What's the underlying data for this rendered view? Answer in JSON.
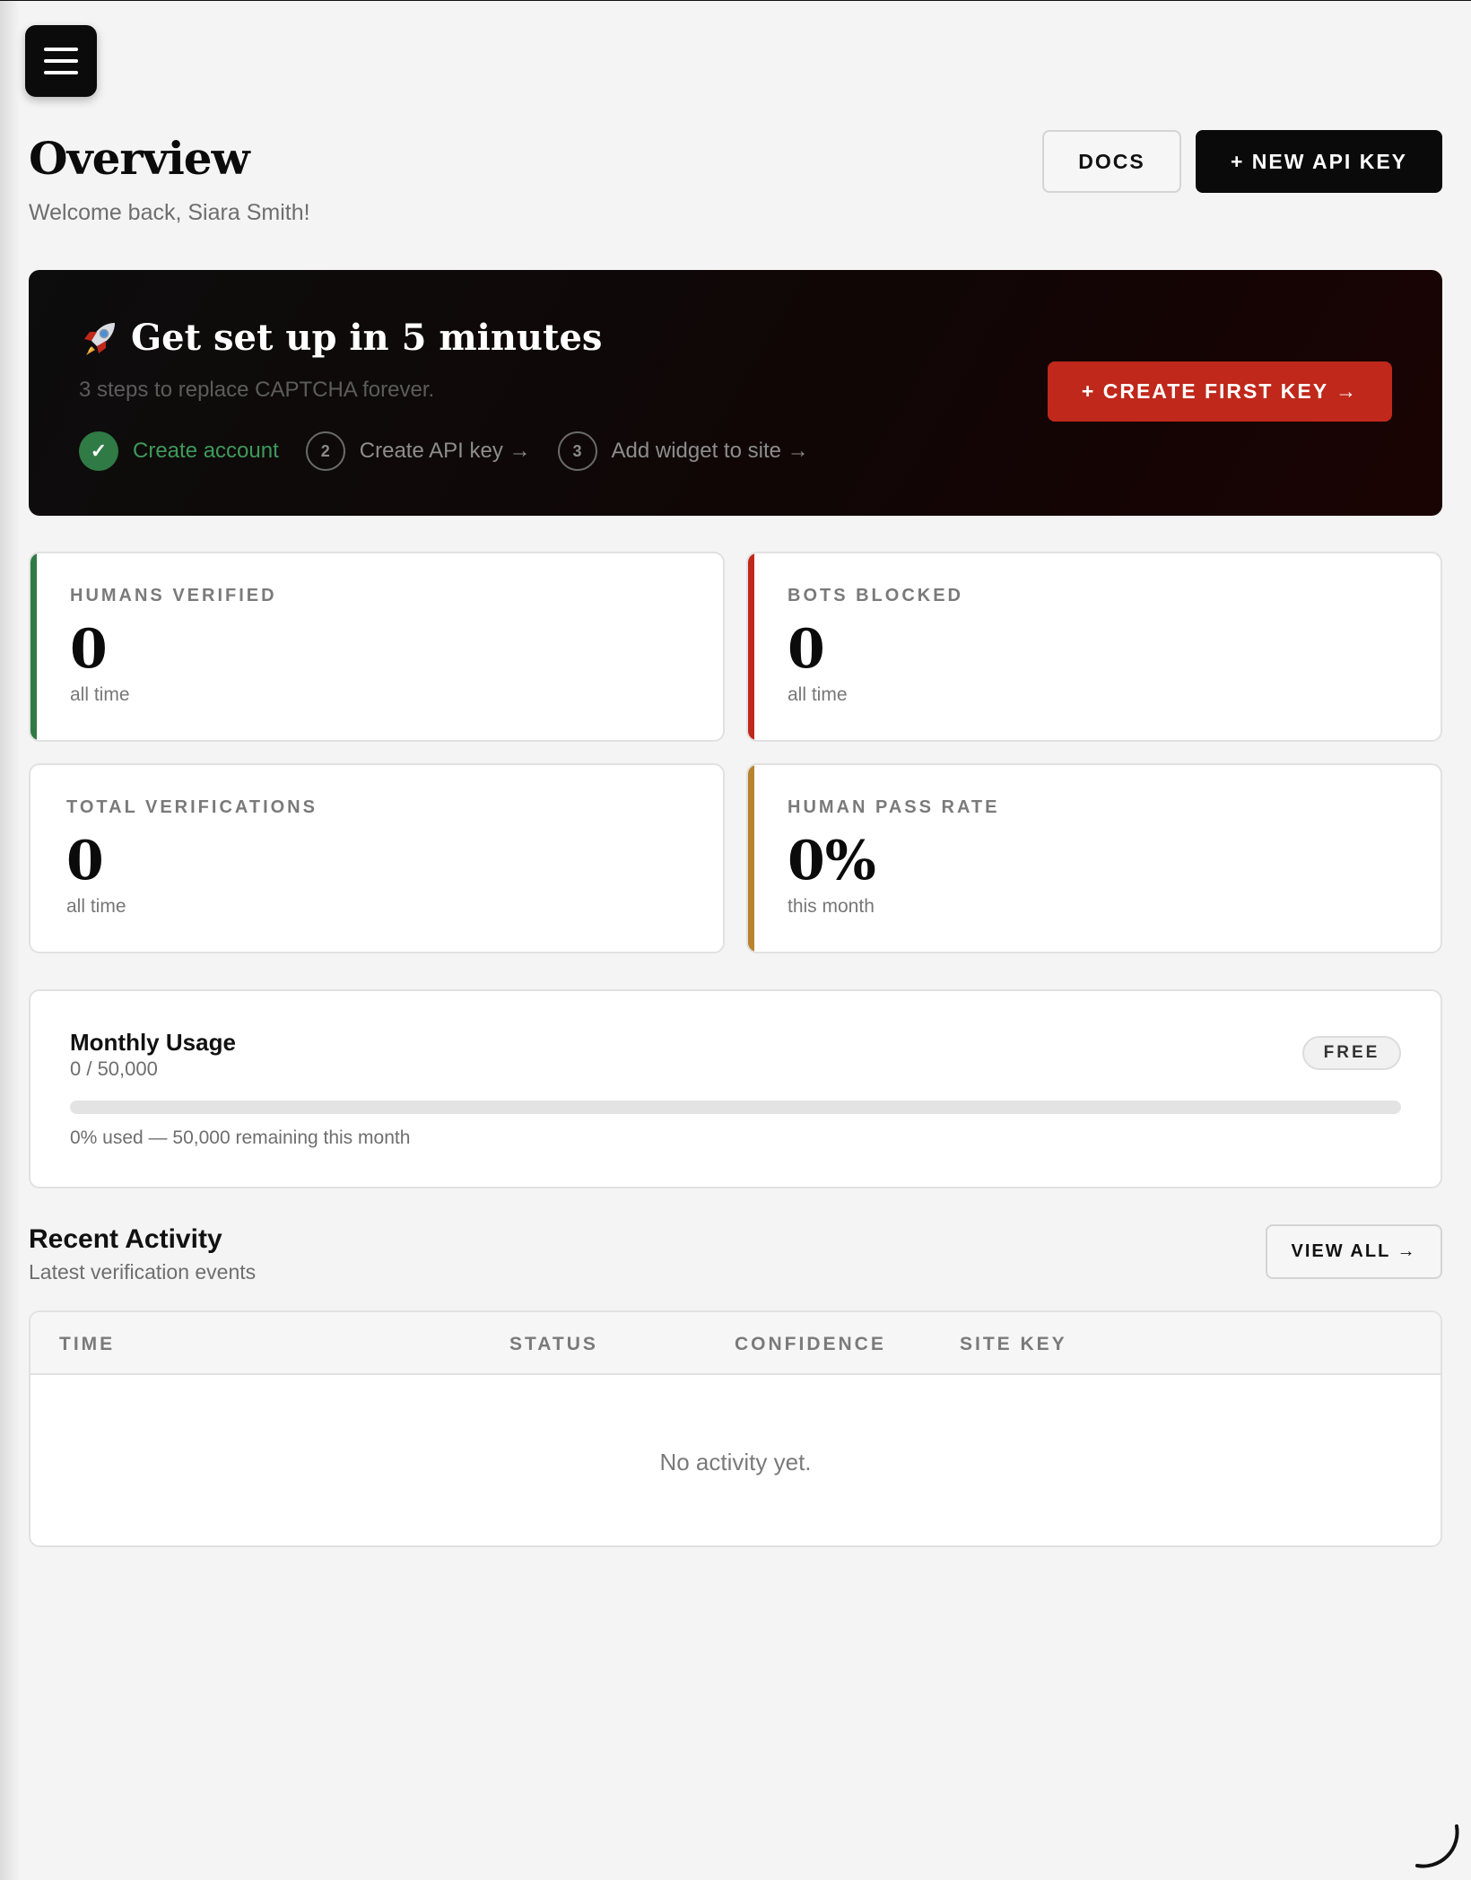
{
  "header": {
    "title": "Overview",
    "welcome": "Welcome back, Siara Smith!",
    "docs_label": "DOCS",
    "new_key_label": "+ NEW API KEY"
  },
  "setup": {
    "title": "Get set up in 5 minutes",
    "subtitle": "3 steps to replace CAPTCHA forever.",
    "steps": [
      {
        "marker": "✓",
        "label": "Create account",
        "done": true
      },
      {
        "marker": "2",
        "label": "Create API key →",
        "done": false
      },
      {
        "marker": "3",
        "label": "Add widget to site →",
        "done": false
      }
    ],
    "cta_label": "+ CREATE FIRST KEY →"
  },
  "stats": [
    {
      "label": "HUMANS VERIFIED",
      "value": "0",
      "period": "all time",
      "accent": "#2f7a45"
    },
    {
      "label": "BOTS BLOCKED",
      "value": "0",
      "period": "all time",
      "accent": "#c0281b"
    },
    {
      "label": "TOTAL VERIFICATIONS",
      "value": "0",
      "period": "all time",
      "accent": ""
    },
    {
      "label": "HUMAN PASS RATE",
      "value": "0%",
      "period": "this month",
      "accent": "#b8822e"
    }
  ],
  "usage": {
    "title": "Monthly Usage",
    "count": "0 / 50,000",
    "plan": "FREE",
    "used_fraction": 0,
    "note": "0% used — 50,000 remaining this month"
  },
  "activity": {
    "title": "Recent Activity",
    "subtitle": "Latest verification events",
    "view_all_label": "VIEW ALL →",
    "columns": [
      "TIME",
      "STATUS",
      "CONFIDENCE",
      "SITE KEY"
    ],
    "empty_message": "No activity yet."
  },
  "icons": {
    "menu": "hamburger-menu-icon",
    "rocket": "rocket-icon",
    "loader": "loading-spinner-icon"
  },
  "colors": {
    "primary": "#0a0a0a",
    "danger": "#c0281b",
    "success": "#2f7a45",
    "warning": "#b8822e"
  }
}
